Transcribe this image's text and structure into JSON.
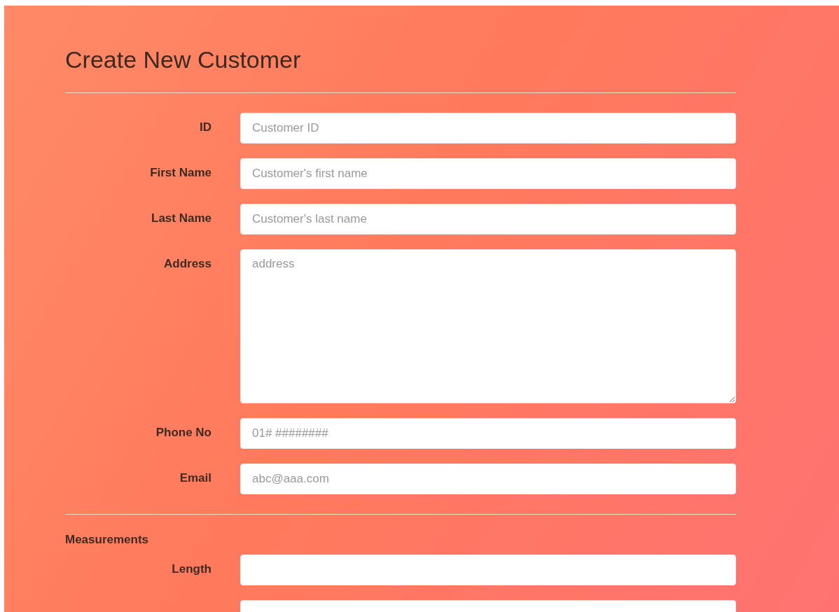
{
  "title": "Create New Customer",
  "fields": [
    {
      "kind": "input",
      "label": "ID",
      "placeholder": "Customer ID"
    },
    {
      "kind": "input",
      "label": "First Name",
      "placeholder": "Customer's first name"
    },
    {
      "kind": "input",
      "label": "Last Name",
      "placeholder": "Customer's last name"
    },
    {
      "kind": "textarea",
      "label": "Address",
      "placeholder": "address"
    },
    {
      "kind": "input",
      "label": "Phone No",
      "placeholder": "01# ########"
    },
    {
      "kind": "input",
      "label": "Email",
      "placeholder": "abc@aaa.com"
    }
  ],
  "measurements": {
    "heading": "Measurements",
    "fields": [
      {
        "kind": "input",
        "label": "Length"
      },
      {
        "kind": "input"
      }
    ]
  }
}
